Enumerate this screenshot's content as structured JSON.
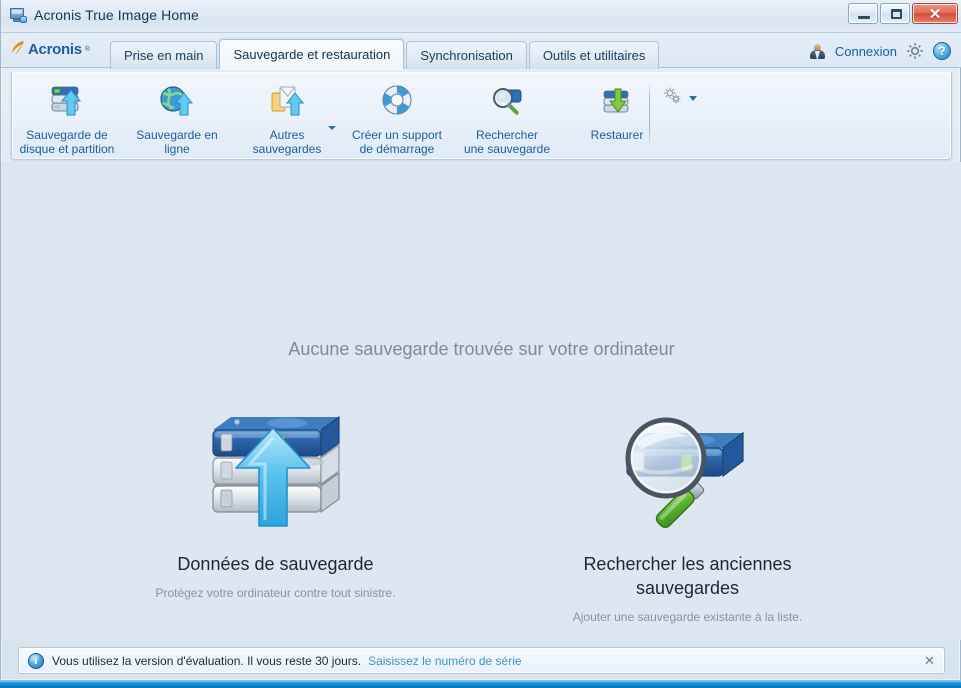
{
  "window": {
    "title": "Acronis True Image Home",
    "app_icon": "monitor-icon",
    "buttons": {
      "minimize": "minimize-button",
      "maximize": "maximize-button",
      "close_glyph": "✕"
    }
  },
  "brand": {
    "name": "Acronis",
    "registered": "®",
    "color": "#1b5fa8",
    "swoosh_color": "#f08a1c"
  },
  "tabs": [
    {
      "label": "Prise en main",
      "active": false
    },
    {
      "label": "Sauvegarde et restauration",
      "active": true
    },
    {
      "label": "Synchronisation",
      "active": false
    },
    {
      "label": "Outils et utilitaires",
      "active": false
    }
  ],
  "account": {
    "login_label": "Connexion",
    "settings_icon": "gear-icon",
    "help_icon": "help-icon",
    "help_glyph": "?"
  },
  "toolbar": {
    "items": [
      {
        "label": "Sauvegarde de\ndisque et partition",
        "icon": "disk-backup-icon",
        "dropdown": false
      },
      {
        "label": "Sauvegarde en\nligne",
        "icon": "online-backup-icon",
        "dropdown": false
      },
      {
        "label": "Autres\nsauvegardes",
        "icon": "other-backups-icon",
        "dropdown": true
      },
      {
        "label": "Créer un support\nde démarrage",
        "icon": "rescue-media-icon",
        "dropdown": false
      },
      {
        "label": "Rechercher\nune sauvegarde",
        "icon": "search-backup-icon",
        "dropdown": false
      },
      {
        "label": "Restaurer",
        "icon": "restore-icon",
        "dropdown": false
      }
    ],
    "overflow": {
      "icon": "gears-icon",
      "dropdown": true
    }
  },
  "main": {
    "headline": "Aucune sauvegarde trouvée sur votre ordinateur",
    "cards": [
      {
        "icon": "disk-stack-upload-icon",
        "title": "Données de sauvegarde",
        "subtitle": "Protégez votre ordinateur contre tout sinistre."
      },
      {
        "icon": "magnifier-disk-icon",
        "title": "Rechercher les anciennes sauvegardes",
        "subtitle": "Ajouter une sauvegarde existante à la liste."
      }
    ]
  },
  "status": {
    "icon": "info-icon",
    "icon_glyph": "i",
    "message": "Vous utilisez la version d'évaluation. Il vous reste 30 jours.",
    "link": "Saisissez le numéro de série",
    "close_glyph": "✕"
  }
}
